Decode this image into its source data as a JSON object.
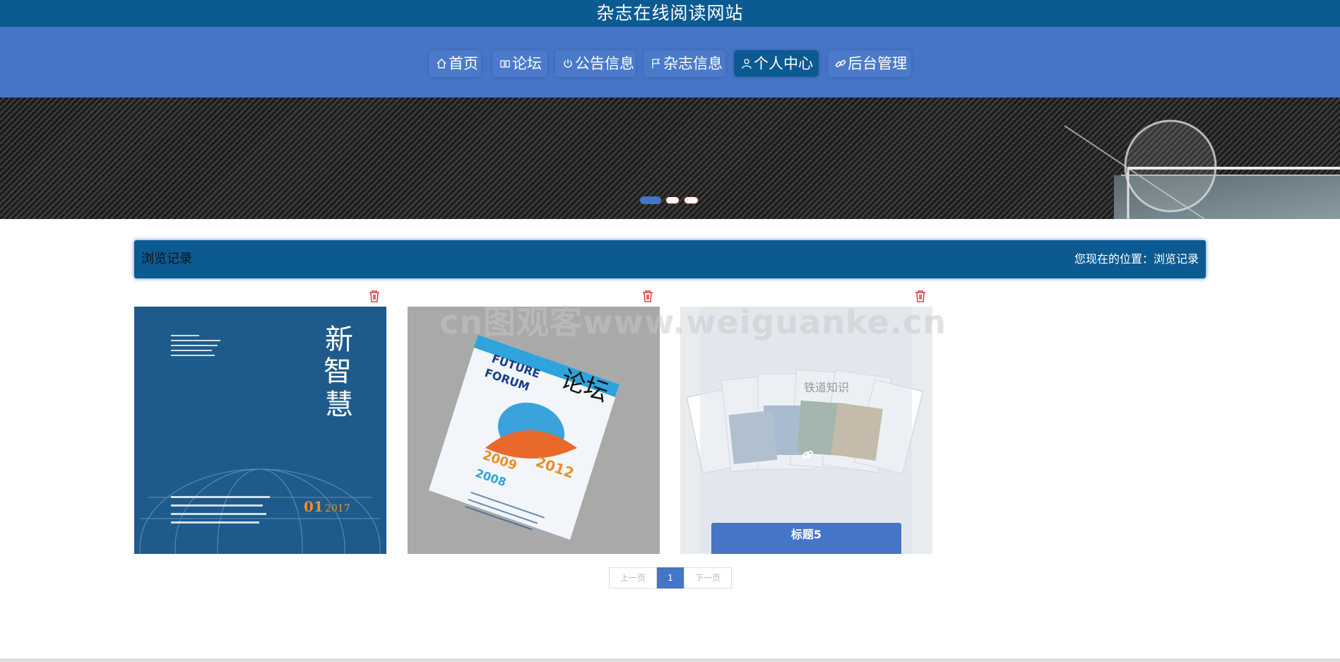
{
  "site": {
    "title": "杂志在线阅读网站"
  },
  "nav": {
    "items": [
      {
        "label": "首页",
        "icon": "home-icon",
        "active": false
      },
      {
        "label": "论坛",
        "icon": "forum-icon",
        "active": false
      },
      {
        "label": "公告信息",
        "icon": "power-icon",
        "active": false
      },
      {
        "label": "杂志信息",
        "icon": "flag-icon",
        "active": false
      },
      {
        "label": "个人中心",
        "icon": "user-icon",
        "active": true
      },
      {
        "label": "后台管理",
        "icon": "link-icon",
        "active": false
      }
    ]
  },
  "carousel": {
    "slides": 3,
    "active_index": 0
  },
  "section": {
    "title": "浏览记录",
    "breadcrumb_prefix": "您现在的位置：",
    "breadcrumb_current": "浏览记录"
  },
  "records": [
    {
      "cover": "新智慧 magazine cover",
      "cover_text": "新智慧",
      "caption": ""
    },
    {
      "cover": "论坛 Future Forum magazine cover",
      "cover_text": "论坛",
      "caption": ""
    },
    {
      "cover": "铁道知识 magazine collage",
      "cover_text": "铁道知识",
      "caption": "标题5"
    }
  ],
  "pagination": {
    "prev_label": "上一页",
    "current_page": "1",
    "next_label": "下一页"
  },
  "watermark": "cn图观客www.weiguanke.cn",
  "colors": {
    "header": "#0c5a92",
    "nav": "#4675c8",
    "accent": "#4675c8",
    "delete": "#e04040"
  }
}
